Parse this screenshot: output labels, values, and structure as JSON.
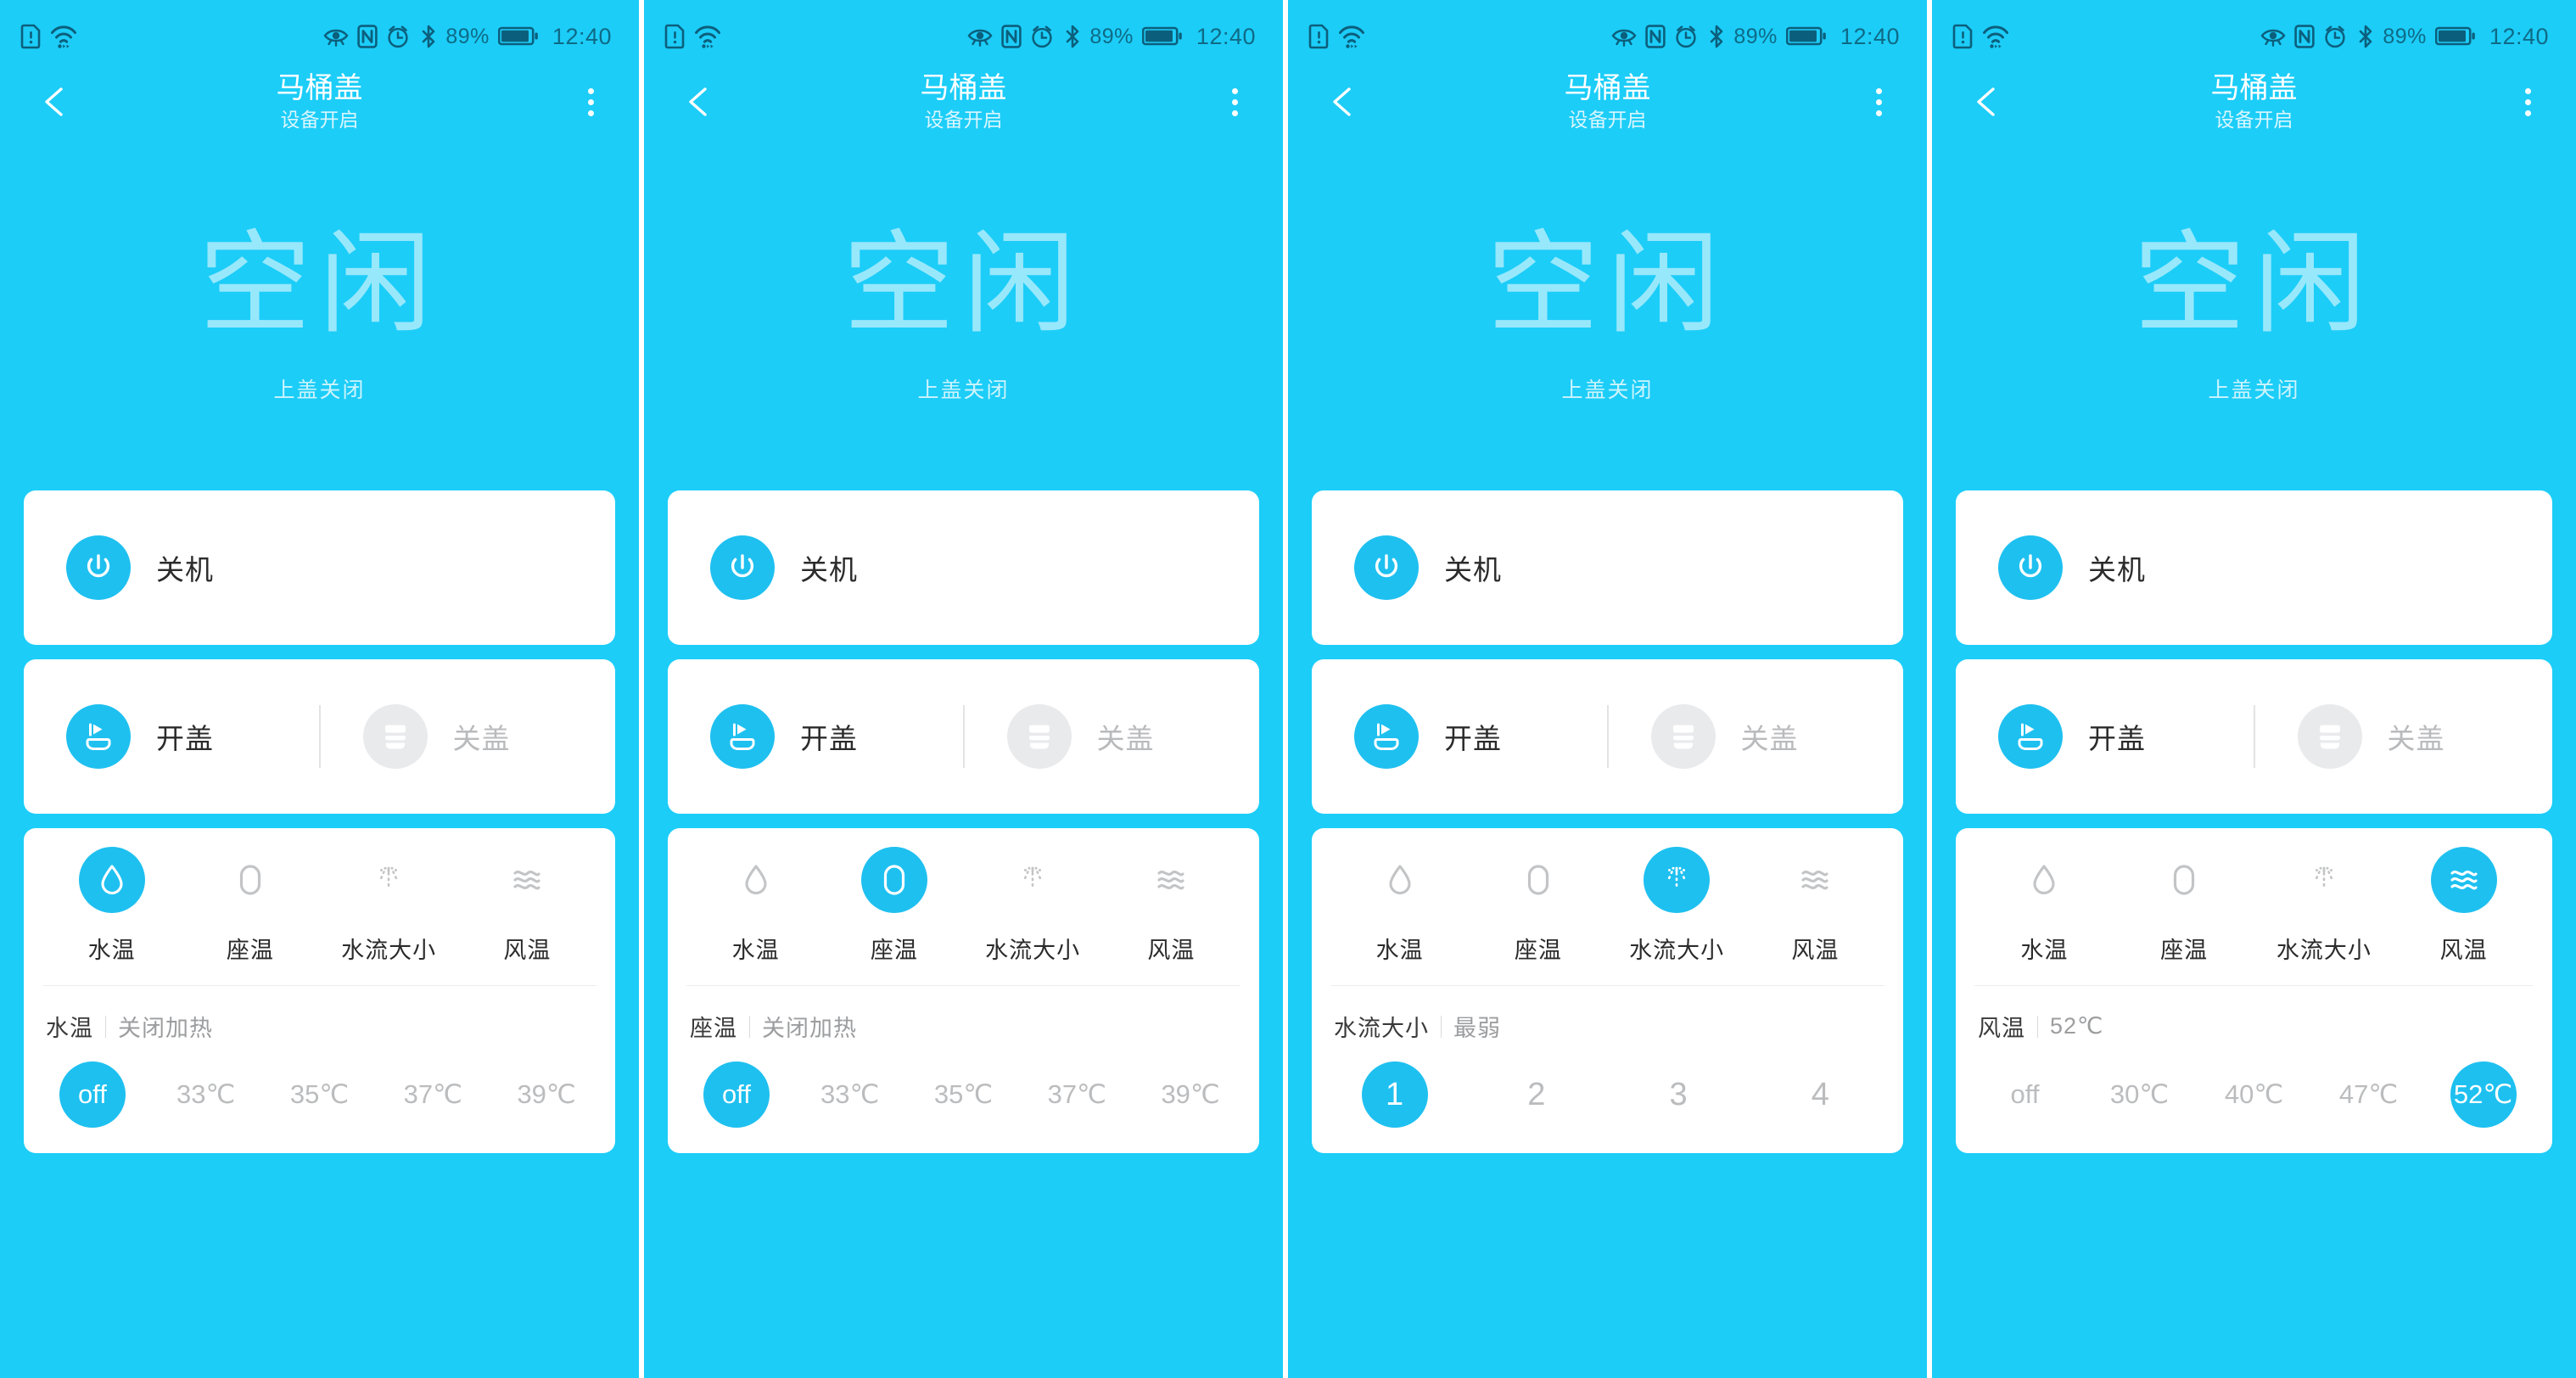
{
  "theme": {
    "brand_blue": "#1ccdf8",
    "accent_blue": "#1ec0f0",
    "card_white": "#ffffff",
    "muted_grey": "#bbbcbe",
    "outer_blue": "#1eaee0"
  },
  "status_bar": {
    "sim_icon": "sim-alert-icon",
    "wifi_icon": "wifi-icon",
    "eye_icon": "eye-care-icon",
    "nfc_icon": "nfc-icon",
    "alarm_icon": "alarm-clock-icon",
    "bluetooth_icon": "bluetooth-icon",
    "battery_pct": "89%",
    "battery_icon": "battery-icon",
    "time": "12:40"
  },
  "header": {
    "back_icon": "chevron-left-icon",
    "title": "马桶盖",
    "subtitle": "设备开启",
    "menu_icon": "overflow-menu-icon"
  },
  "hero": {
    "state": "空闲",
    "sub": "上盖关闭"
  },
  "power_card": {
    "icon": "power-icon",
    "label": "关机"
  },
  "lid_card": {
    "open": {
      "icon": "lid-open-icon",
      "label": "开盖",
      "enabled": true
    },
    "close": {
      "icon": "lid-close-icon",
      "label": "关盖",
      "enabled": false
    }
  },
  "tabs": [
    {
      "icon": "water-drop-icon",
      "label": "水温"
    },
    {
      "icon": "seat-icon",
      "label": "座温"
    },
    {
      "icon": "spray-icon",
      "label": "水流大小"
    },
    {
      "icon": "wind-icon",
      "label": "风温"
    }
  ],
  "panels": [
    {
      "active_tab": 0,
      "current": {
        "name": "水温",
        "value": "关闭加热"
      },
      "levels": [
        "off",
        "33℃",
        "35℃",
        "37℃",
        "39℃"
      ],
      "selected_level": 0
    },
    {
      "active_tab": 1,
      "current": {
        "name": "座温",
        "value": "关闭加热"
      },
      "levels": [
        "off",
        "33℃",
        "35℃",
        "37℃",
        "39℃"
      ],
      "selected_level": 0
    },
    {
      "active_tab": 2,
      "current": {
        "name": "水流大小",
        "value": "最弱"
      },
      "levels": [
        "1",
        "2",
        "3",
        "4"
      ],
      "selected_level": 0
    },
    {
      "active_tab": 3,
      "current": {
        "name": "风温",
        "value": "52℃"
      },
      "levels": [
        "off",
        "30℃",
        "40℃",
        "47℃",
        "52℃"
      ],
      "selected_level": 4
    }
  ]
}
